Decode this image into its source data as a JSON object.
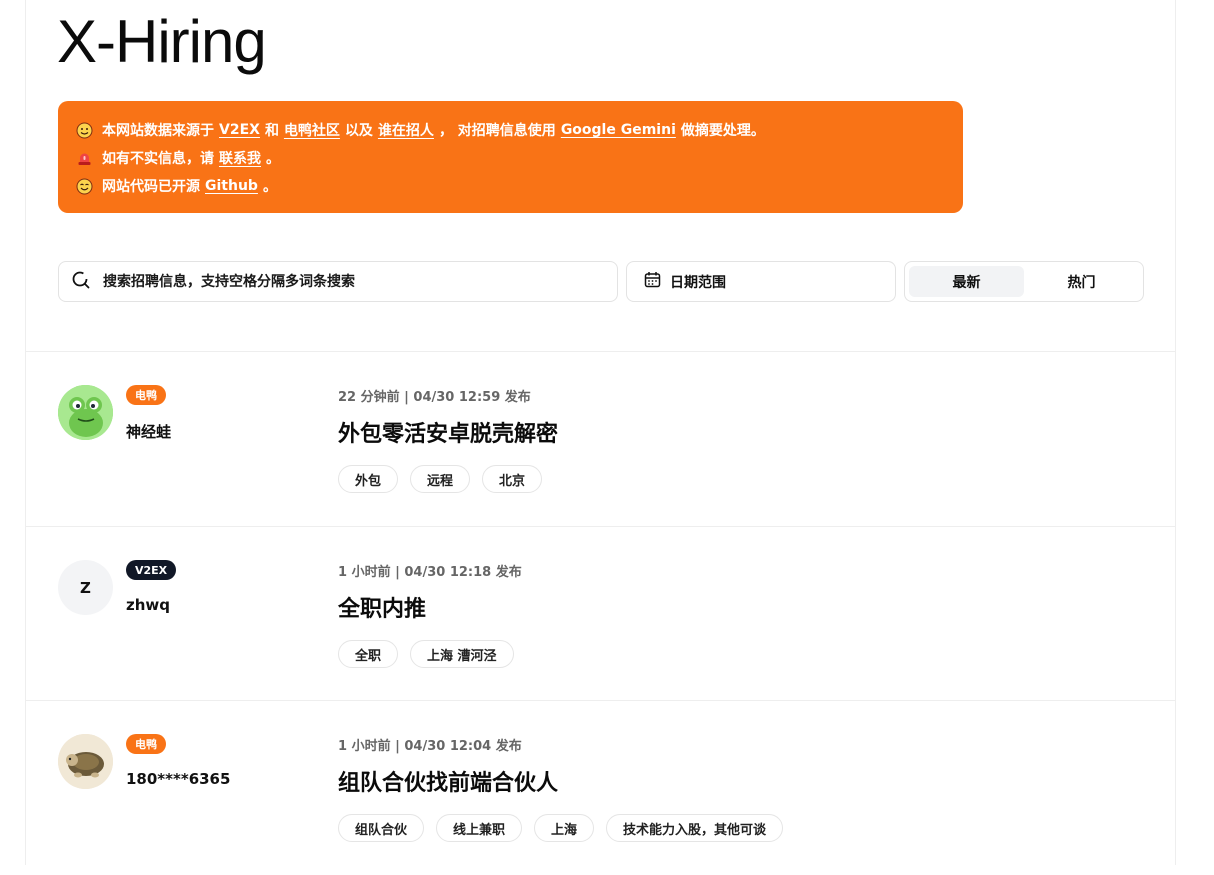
{
  "site_title": "X-Hiring",
  "notice": {
    "line1": {
      "t1": "本网站数据来源于",
      "l1": "V2EX",
      "t2": "和",
      "l2": "电鸭社区",
      "t3": "以及",
      "l3": "谁在招人",
      "t4": "，  对招聘信息使用",
      "l4": "Google Gemini",
      "t5": "做摘要处理。"
    },
    "line2": {
      "t1": "如有不实信息，请",
      "l1": "联系我",
      "t2": "。"
    },
    "line3": {
      "t1": "网站代码已开源",
      "l1": "Github",
      "t2": "。"
    },
    "icons": [
      "smiling-face-icon",
      "siren-icon",
      "smiling-face-icon"
    ]
  },
  "search": {
    "placeholder": "搜索招聘信息，支持空格分隔多词条搜索"
  },
  "date_range": {
    "label": "日期范围"
  },
  "sort": {
    "latest": "最新",
    "hot": "热门",
    "selected": "最新"
  },
  "colors": {
    "accent": "#f97316",
    "badge_dianya": "#f97316",
    "badge_v2ex": "#111827"
  },
  "posts": [
    {
      "source": "电鸭",
      "username": "神经蛙",
      "meta": "22 分钟前 | 04/30 12:59 发布",
      "title": "外包零活安卓脱壳解密",
      "tags": [
        "外包",
        "远程",
        "北京"
      ]
    },
    {
      "source": "V2EX",
      "avatar_letter": "Z",
      "username": "zhwq",
      "meta": "1 小时前 | 04/30 12:18 发布",
      "title": "全职内推",
      "tags": [
        "全职",
        "上海 漕河泾"
      ]
    },
    {
      "source": "电鸭",
      "username": "180****6365",
      "meta": "1 小时前 | 04/30 12:04 发布",
      "title": "组队合伙找前端合伙人",
      "tags": [
        "组队合伙",
        "线上兼职",
        "上海",
        "技术能力入股，其他可谈"
      ]
    }
  ]
}
